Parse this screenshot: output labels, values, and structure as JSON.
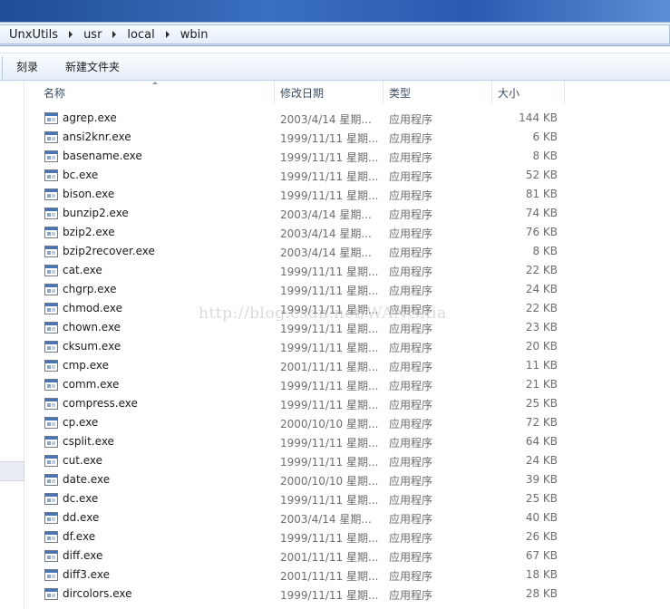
{
  "address_bar": {
    "crumbs": [
      "UnxUtils",
      "usr",
      "local",
      "wbin"
    ]
  },
  "toolbar": {
    "burn_label": "刻录",
    "new_folder_label": "新建文件夹"
  },
  "columns": {
    "name": "名称",
    "date": "修改日期",
    "type": "类型",
    "size": "大小"
  },
  "icons": {
    "file": "application-exe-icon"
  },
  "files": [
    {
      "name": "agrep.exe",
      "date": "2003/4/14 星期...",
      "type": "应用程序",
      "size": "144 KB"
    },
    {
      "name": "ansi2knr.exe",
      "date": "1999/11/11 星期...",
      "type": "应用程序",
      "size": "6 KB"
    },
    {
      "name": "basename.exe",
      "date": "1999/11/11 星期...",
      "type": "应用程序",
      "size": "8 KB"
    },
    {
      "name": "bc.exe",
      "date": "1999/11/11 星期...",
      "type": "应用程序",
      "size": "52 KB"
    },
    {
      "name": "bison.exe",
      "date": "1999/11/11 星期...",
      "type": "应用程序",
      "size": "81 KB"
    },
    {
      "name": "bunzip2.exe",
      "date": "2003/4/14 星期...",
      "type": "应用程序",
      "size": "74 KB"
    },
    {
      "name": "bzip2.exe",
      "date": "2003/4/14 星期...",
      "type": "应用程序",
      "size": "76 KB"
    },
    {
      "name": "bzip2recover.exe",
      "date": "2003/4/14 星期...",
      "type": "应用程序",
      "size": "8 KB"
    },
    {
      "name": "cat.exe",
      "date": "1999/11/11 星期...",
      "type": "应用程序",
      "size": "22 KB"
    },
    {
      "name": "chgrp.exe",
      "date": "1999/11/11 星期...",
      "type": "应用程序",
      "size": "24 KB"
    },
    {
      "name": "chmod.exe",
      "date": "1999/11/11 星期...",
      "type": "应用程序",
      "size": "22 KB"
    },
    {
      "name": "chown.exe",
      "date": "1999/11/11 星期...",
      "type": "应用程序",
      "size": "23 KB"
    },
    {
      "name": "cksum.exe",
      "date": "1999/11/11 星期...",
      "type": "应用程序",
      "size": "20 KB"
    },
    {
      "name": "cmp.exe",
      "date": "2001/11/11 星期...",
      "type": "应用程序",
      "size": "11 KB"
    },
    {
      "name": "comm.exe",
      "date": "1999/11/11 星期...",
      "type": "应用程序",
      "size": "21 KB"
    },
    {
      "name": "compress.exe",
      "date": "1999/11/11 星期...",
      "type": "应用程序",
      "size": "25 KB"
    },
    {
      "name": "cp.exe",
      "date": "2000/10/10 星期...",
      "type": "应用程序",
      "size": "72 KB"
    },
    {
      "name": "csplit.exe",
      "date": "1999/11/11 星期...",
      "type": "应用程序",
      "size": "64 KB"
    },
    {
      "name": "cut.exe",
      "date": "1999/11/11 星期...",
      "type": "应用程序",
      "size": "24 KB"
    },
    {
      "name": "date.exe",
      "date": "2000/10/10 星期...",
      "type": "应用程序",
      "size": "39 KB"
    },
    {
      "name": "dc.exe",
      "date": "1999/11/11 星期...",
      "type": "应用程序",
      "size": "25 KB"
    },
    {
      "name": "dd.exe",
      "date": "2003/4/14 星期...",
      "type": "应用程序",
      "size": "40 KB"
    },
    {
      "name": "df.exe",
      "date": "1999/11/11 星期...",
      "type": "应用程序",
      "size": "26 KB"
    },
    {
      "name": "diff.exe",
      "date": "2001/11/11 星期...",
      "type": "应用程序",
      "size": "67 KB"
    },
    {
      "name": "diff3.exe",
      "date": "2001/11/11 星期...",
      "type": "应用程序",
      "size": "18 KB"
    },
    {
      "name": "dircolors.exe",
      "date": "1999/11/11 星期...",
      "type": "应用程序",
      "size": "28 KB"
    }
  ],
  "watermark": "http://blog.csdn.net/WANGXia"
}
